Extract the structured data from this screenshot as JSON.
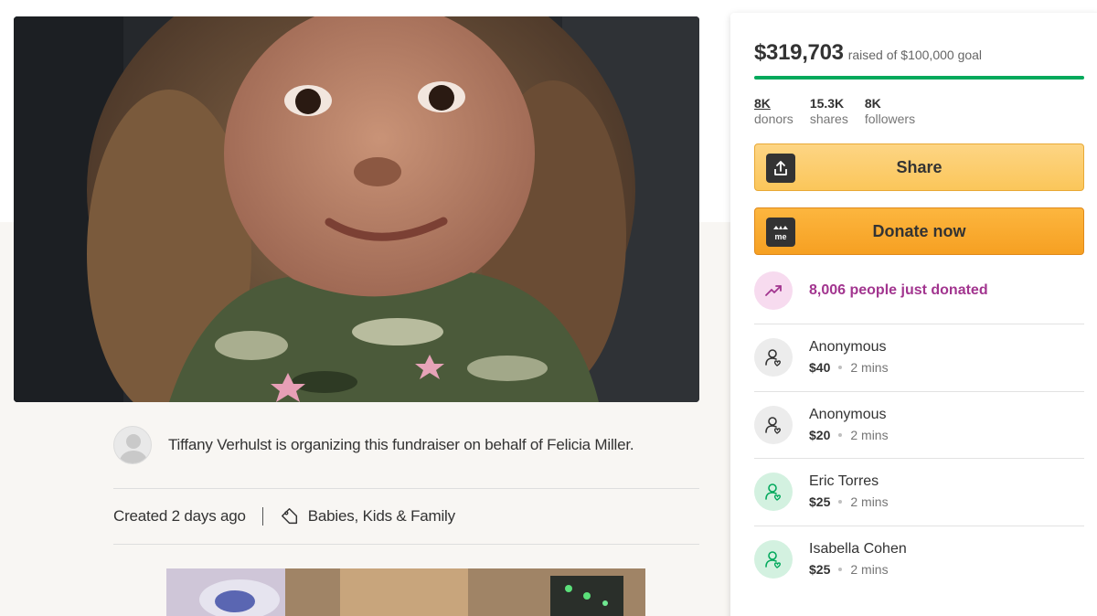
{
  "organizer": {
    "text": "Tiffany Verhulst is organizing this fundraiser on behalf of Felicia Miller."
  },
  "meta": {
    "created": "Created 2 days ago",
    "category": "Babies, Kids & Family",
    "category_icon": "tag-icon"
  },
  "campaign": {
    "raised": "$319,703",
    "goal_text": "raised of $100,000 goal",
    "progress_fraction": 1.0,
    "progress_color": "#02a95c",
    "stats": [
      {
        "value": "8K",
        "label": "donors"
      },
      {
        "value": "15.3K",
        "label": "shares"
      },
      {
        "value": "8K",
        "label": "followers"
      }
    ],
    "share_label": "Share",
    "donate_label": "Donate now",
    "donate_icon_text": "me",
    "trend_text": "8,006 people just donated",
    "trend_color": "#a2358f"
  },
  "donations": [
    {
      "name": "Anonymous",
      "amount": "$40",
      "time": "2 mins",
      "style": "gray"
    },
    {
      "name": "Anonymous",
      "amount": "$20",
      "time": "2 mins",
      "style": "gray"
    },
    {
      "name": "Eric Torres",
      "amount": "$25",
      "time": "2 mins",
      "style": "green"
    },
    {
      "name": "Isabella Cohen",
      "amount": "$25",
      "time": "2 mins",
      "style": "green"
    }
  ]
}
